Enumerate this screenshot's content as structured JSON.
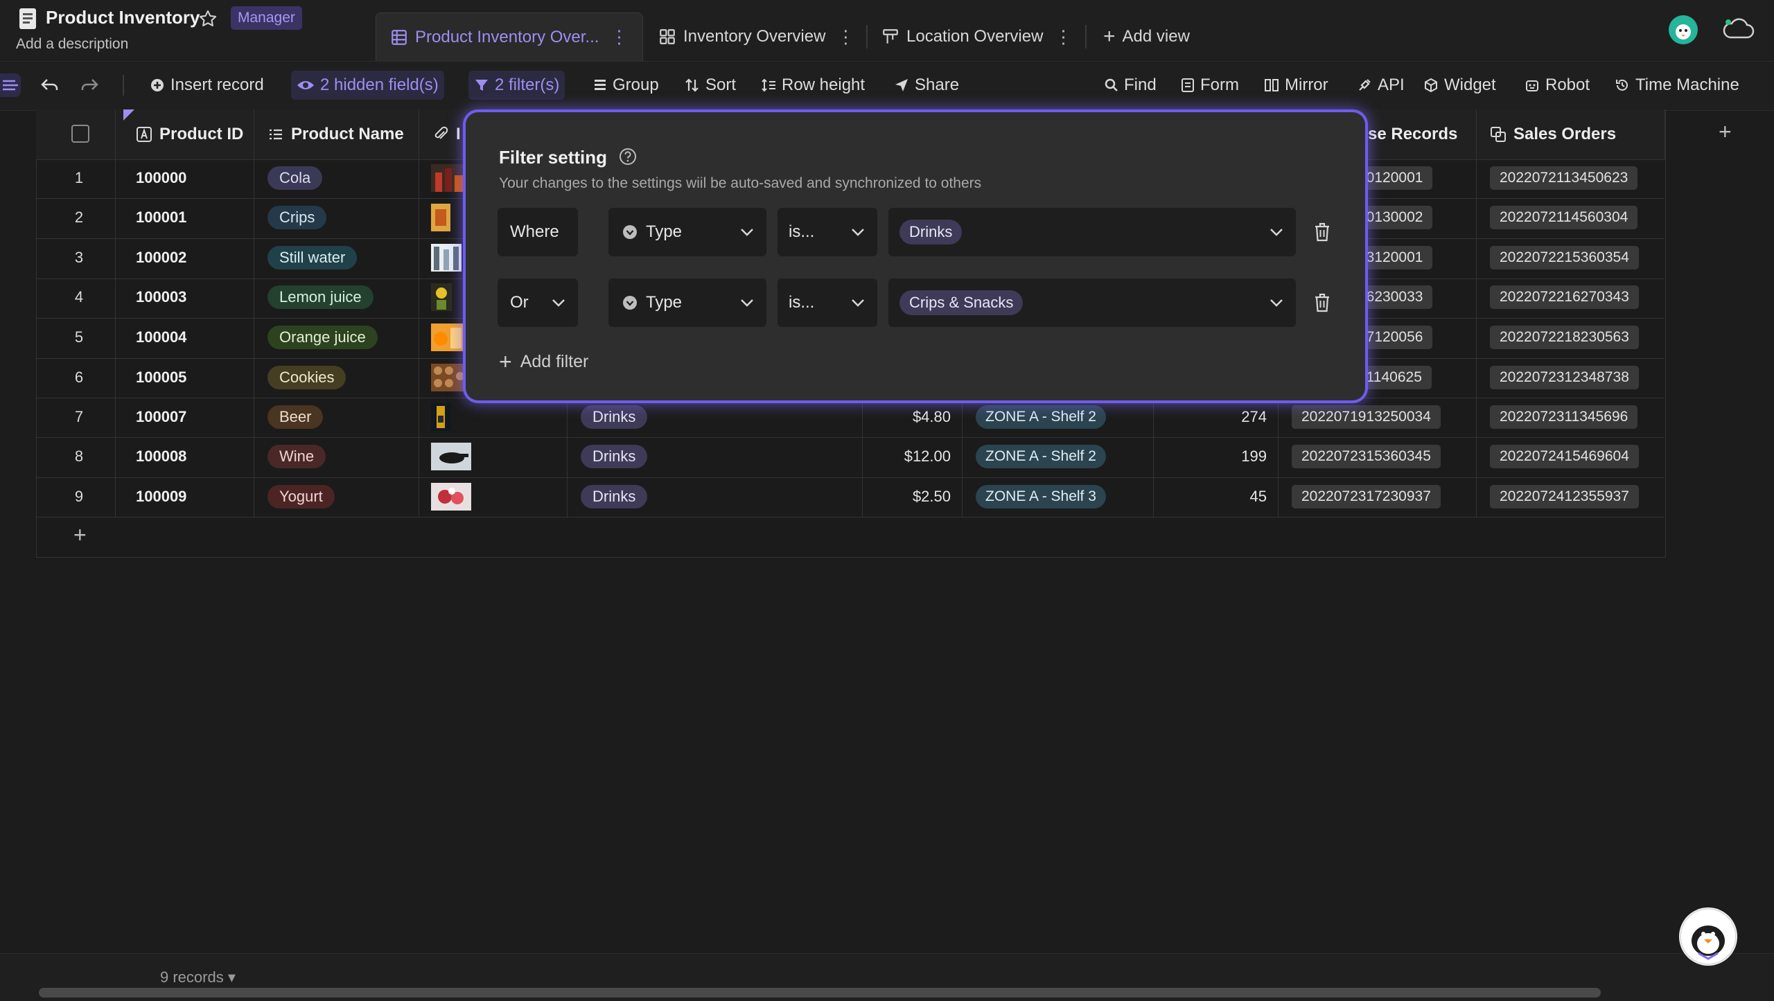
{
  "header": {
    "title": "Product Inventory",
    "role_badge": "Manager",
    "description": "Add a description"
  },
  "tabs": [
    {
      "label": "Product Inventory Over...",
      "active": true
    },
    {
      "label": "Inventory Overview"
    },
    {
      "label": "Location Overview"
    }
  ],
  "add_view_label": "Add view",
  "toolbar": {
    "insert_record": "Insert record",
    "hidden_fields": "2 hidden field(s)",
    "filters": "2 filter(s)",
    "group": "Group",
    "sort": "Sort",
    "row_height": "Row height",
    "share": "Share",
    "find": "Find",
    "form": "Form",
    "mirror": "Mirror",
    "api": "API",
    "widget": "Widget",
    "robot": "Robot",
    "time_machine": "Time Machine"
  },
  "columns": {
    "product_id": "Product ID",
    "product_name": "Product Name",
    "image_partial": "I",
    "purchase_records_partial": "se Records",
    "sales_orders": "Sales Orders"
  },
  "rows": [
    {
      "n": "1",
      "id": "100000",
      "name": "Cola",
      "name_bg": "#3a3a56",
      "po": "10120001",
      "so": "2022072113450623"
    },
    {
      "n": "2",
      "id": "100001",
      "name": "Crips",
      "name_bg": "#243a4a",
      "po": "10130002",
      "so": "2022072114560304"
    },
    {
      "n": "3",
      "id": "100002",
      "name": "Still water",
      "name_bg": "#21414a",
      "po": "13120001",
      "so": "2022072215360354"
    },
    {
      "n": "4",
      "id": "100003",
      "name": "Lemon juice",
      "name_bg": "#24402f",
      "po": "16230033",
      "so": "2022072216270343"
    },
    {
      "n": "5",
      "id": "100004",
      "name": "Orange juice",
      "name_bg": "#2d4320",
      "po": "17120056",
      "so": "2022072218230563"
    },
    {
      "n": "6",
      "id": "100005",
      "name": "Cookies",
      "name_bg": "#463e22",
      "po": "21140625",
      "so": "2022072312348738"
    },
    {
      "n": "7",
      "id": "100007",
      "name": "Beer",
      "name_bg": "#4a3422",
      "type": "Drinks",
      "price": "$4.80",
      "loc": "ZONE A - Shelf 2",
      "qty": "274",
      "po": "2022071913250034",
      "so": "2022072311345696"
    },
    {
      "n": "8",
      "id": "100008",
      "name": "Wine",
      "name_bg": "#4a2828",
      "type": "Drinks",
      "price": "$12.00",
      "loc": "ZONE A - Shelf 2",
      "qty": "199",
      "po": "2022072315360345",
      "so": "2022072415469604"
    },
    {
      "n": "9",
      "id": "100009",
      "name": "Yogurt",
      "name_bg": "#4d2424",
      "type": "Drinks",
      "price": "$2.50",
      "loc": "ZONE A - Shelf 3",
      "qty": "45",
      "po": "2022072317230937",
      "so": "2022072412355937"
    }
  ],
  "filter_panel": {
    "title": "Filter setting",
    "hint": "Your changes to the settings wiil be auto-saved and synchronized to others",
    "conditions": [
      {
        "conjunction": "Where",
        "field": "Type",
        "operator": "is...",
        "value": "Drinks"
      },
      {
        "conjunction": "Or",
        "field": "Type",
        "operator": "is...",
        "value": "Crips & Snacks"
      }
    ],
    "add_filter": "Add filter"
  },
  "footer": {
    "records": "9 records ▾"
  },
  "colors": {
    "accent": "#9f8df2",
    "glow": "#6e5cf0",
    "background": "#1c1c1c"
  }
}
